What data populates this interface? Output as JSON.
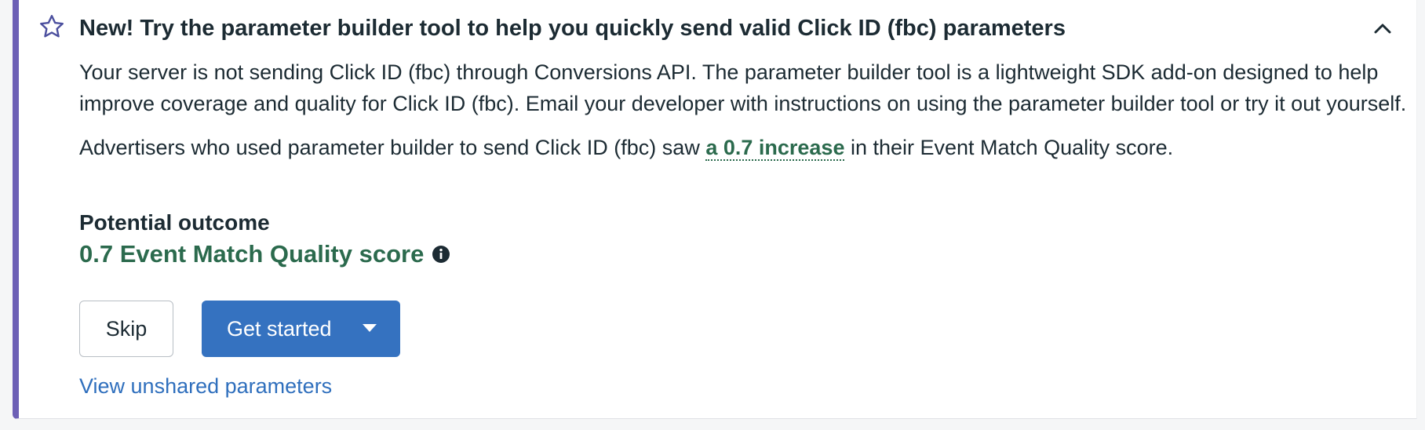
{
  "card": {
    "title": "New! Try the parameter builder tool to help you quickly send valid Click ID (fbc) parameters",
    "accent_color": "#6c5fb5",
    "icon": "star-icon",
    "collapse_icon": "chevron-up-icon",
    "description": "Your server is not sending Click ID (fbc) through Conversions API. The parameter builder tool is a lightweight SDK add-on designed to help improve coverage and quality for Click ID (fbc). Email your developer with instructions on using the parameter builder tool or try it out yourself.",
    "stat_prefix": "Advertisers who used parameter builder to send Click ID (fbc) saw ",
    "stat_link": "a 0.7 increase",
    "stat_suffix": " in their Event Match Quality score.",
    "outcome_label": "Potential outcome",
    "outcome_value": "0.7 Event Match Quality score",
    "outcome_color": "#2b6a4d",
    "info_icon": "info-icon",
    "skip_label": "Skip",
    "get_started_label": "Get started",
    "get_started_color": "#3572c0",
    "dropdown_icon": "caret-down-icon",
    "view_link": "View unshared parameters"
  }
}
